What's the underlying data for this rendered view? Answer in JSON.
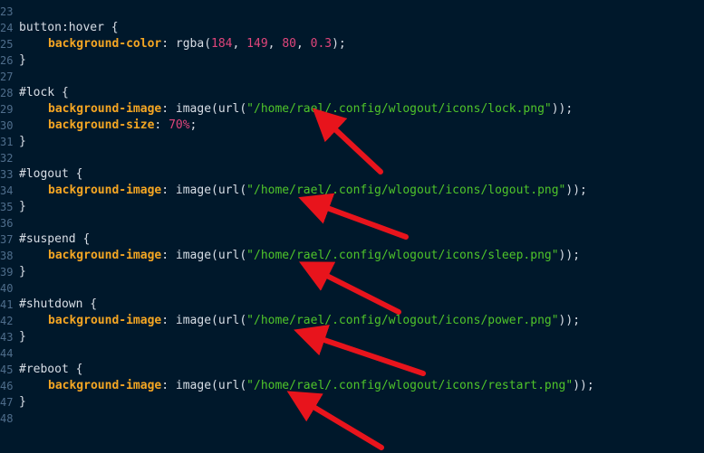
{
  "editor": {
    "line_numbers": [
      "23",
      "24",
      "25",
      "26",
      "27",
      "28",
      "29",
      "30",
      "31",
      "32",
      "33",
      "34",
      "35",
      "36",
      "37",
      "38",
      "39",
      "40",
      "41",
      "42",
      "43",
      "44",
      "45",
      "46",
      "47",
      "48"
    ],
    "lines": {
      "l24_sel": "button:hover",
      "l25_prop": "background-color",
      "l25_fn": "rgba(",
      "l25_n1": "184",
      "l25_n2": "149",
      "l25_n3": "80",
      "l25_n4": "0.3",
      "l28_sel": "#lock",
      "l29_prop": "background-image",
      "l29_fn": "image(url(",
      "l29_str": "\"/home/rael/.config/wlogout/icons/lock.png\"",
      "l30_prop": "background-size",
      "l30_num": "70%",
      "l33_sel": "#logout",
      "l34_prop": "background-image",
      "l34_fn": "image(url(",
      "l34_str": "\"/home/rael/.config/wlogout/icons/logout.png\"",
      "l37_sel": "#suspend",
      "l38_prop": "background-image",
      "l38_fn": "image(url(",
      "l38_str": "\"/home/rael/.config/wlogout/icons/sleep.png\"",
      "l41_sel": "#shutdown",
      "l42_prop": "background-image",
      "l42_fn": "image(url(",
      "l42_str": "\"/home/rael/.config/wlogout/icons/power.png\"",
      "l45_sel": "#reboot",
      "l46_prop": "background-image",
      "l46_fn": "image(url(",
      "l46_str": "\"/home/rael/.config/wlogout/icons/restart.png\""
    }
  },
  "colors": {
    "background": "#00182b",
    "property": "#f5a623",
    "string": "#4fc42a",
    "number": "#e0457b",
    "line_number": "#4f6e8c",
    "annotation_arrow": "#e8141c"
  },
  "annotations": {
    "icon": "red-arrow-icon",
    "count": 5
  }
}
